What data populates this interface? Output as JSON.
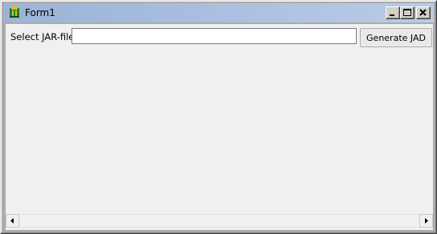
{
  "window": {
    "title": "Form1",
    "icon": "delphi-helmet-icon",
    "controls": [
      "minimize-icon",
      "maximize-icon",
      "close-icon"
    ]
  },
  "form": {
    "jar_label": "Select JAR-file",
    "jar_input_value": "",
    "generate_button_label": "Generate JAD"
  },
  "scrollbar": {
    "orientation": "horizontal",
    "left_icon": "arrow-left-icon",
    "right_icon": "arrow-right-icon"
  },
  "colors": {
    "title_gradient_start": "#9db3d6",
    "title_gradient_end": "#b7cce8",
    "client_background": "#f0f0f0"
  }
}
